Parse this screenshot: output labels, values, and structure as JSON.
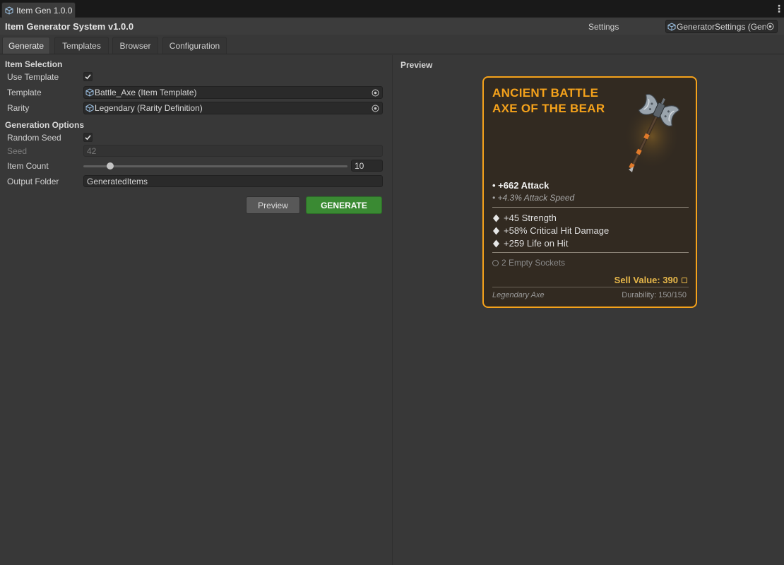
{
  "window": {
    "tab_title": "Item Gen 1.0.0"
  },
  "header": {
    "title": "Item Generator System v1.0.0",
    "settings_label": "Settings",
    "settings_object": "GeneratorSettings (Gene"
  },
  "tabs": [
    {
      "label": "Generate",
      "active": true
    },
    {
      "label": "Templates",
      "active": false
    },
    {
      "label": "Browser",
      "active": false
    },
    {
      "label": "Configuration",
      "active": false
    }
  ],
  "item_selection": {
    "title": "Item Selection",
    "use_template_label": "Use Template",
    "use_template": true,
    "template_label": "Template",
    "template_value": "Battle_Axe (Item Template)",
    "rarity_label": "Rarity",
    "rarity_value": "Legendary (Rarity Definition)"
  },
  "generation_options": {
    "title": "Generation Options",
    "random_seed_label": "Random Seed",
    "random_seed": true,
    "seed_label": "Seed",
    "seed_value": "42",
    "item_count_label": "Item Count",
    "item_count_value": "10",
    "output_folder_label": "Output Folder",
    "output_folder_value": "GeneratedItems"
  },
  "actions": {
    "preview_label": "Preview",
    "generate_label": "GENERATE"
  },
  "preview": {
    "title": "Preview",
    "item_name": "ANCIENT BATTLE AXE OF THE BEAR",
    "primary_stat": "• +662 Attack",
    "secondary_stat": "• +4.3% Attack Speed",
    "affixes": [
      "+45 Strength",
      "+58% Critical Hit Damage",
      "+259 Life on Hit"
    ],
    "sockets": "2 Empty Sockets",
    "sell_value": "Sell Value: 390",
    "item_type": "Legendary Axe",
    "durability": "Durability: 150/150"
  },
  "colors": {
    "rarity_legendary": "#f5a21b",
    "generate_button": "#3a8a33",
    "panel_bg": "#383838"
  },
  "icons": [
    "unity-object-icon",
    "object-picker-icon",
    "checkmark-icon",
    "diamond-bullet-icon",
    "socket-ring-icon",
    "coin-icon",
    "battle-axe-icon",
    "kebab-menu-icon"
  ]
}
